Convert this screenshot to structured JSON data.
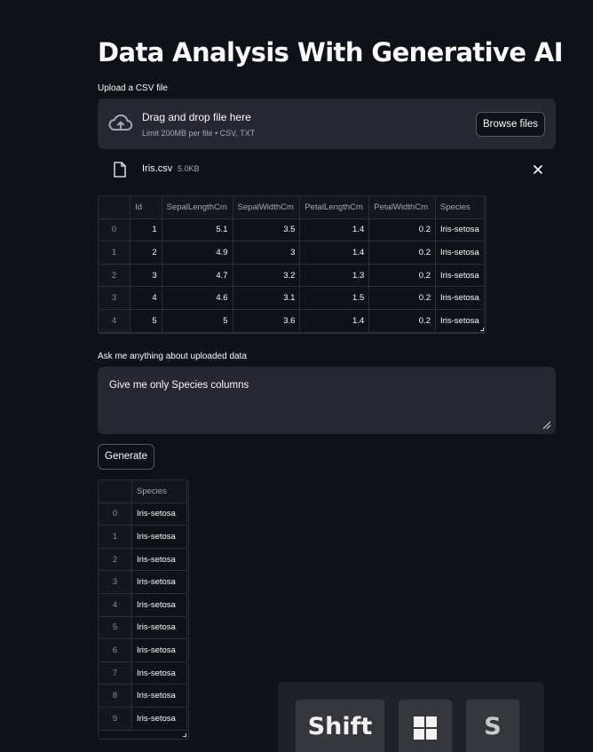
{
  "app": {
    "title": "Data Analysis With Generative AI"
  },
  "uploader": {
    "label": "Upload a CSV file",
    "drop_title": "Drag and drop file here",
    "limit_text": "Limit 200MB per file • CSV, TXT",
    "browse_label": "Browse files",
    "file": {
      "name": "Iris.csv",
      "size": "5.0KB"
    }
  },
  "preview_table": {
    "columns": [
      "",
      "Id",
      "SepalLengthCm",
      "SepalWidthCm",
      "PetalLengthCm",
      "PetalWidthCm",
      "Species"
    ],
    "rows": [
      [
        "0",
        "1",
        "5.1",
        "3.5",
        "1.4",
        "0.2",
        "Iris-setosa"
      ],
      [
        "1",
        "2",
        "4.9",
        "3",
        "1.4",
        "0.2",
        "Iris-setosa"
      ],
      [
        "2",
        "3",
        "4.7",
        "3.2",
        "1.3",
        "0.2",
        "Iris-setosa"
      ],
      [
        "3",
        "4",
        "4.6",
        "3.1",
        "1.5",
        "0.2",
        "Iris-setosa"
      ],
      [
        "4",
        "5",
        "5",
        "3.6",
        "1.4",
        "0.2",
        "Iris-setosa"
      ]
    ]
  },
  "question": {
    "label": "Ask me anything about uploaded data",
    "value": "Give me only Species columns"
  },
  "generate_label": "Generate",
  "result_table": {
    "columns": [
      "",
      "Species"
    ],
    "rows": [
      [
        "0",
        "Iris-setosa"
      ],
      [
        "1",
        "Iris-setosa"
      ],
      [
        "2",
        "Iris-setosa"
      ],
      [
        "3",
        "Iris-setosa"
      ],
      [
        "4",
        "Iris-setosa"
      ],
      [
        "5",
        "Iris-setosa"
      ],
      [
        "6",
        "Iris-setosa"
      ],
      [
        "7",
        "Iris-setosa"
      ],
      [
        "8",
        "Iris-setosa"
      ],
      [
        "9",
        "Iris-setosa"
      ]
    ]
  },
  "keyboard_overlay": {
    "shift_label": "Shift",
    "windows_key_icon": "windows-logo-icon",
    "s_label": "S"
  },
  "colors": {
    "background": "#0e1117",
    "panel": "#262730",
    "muted_text": "#a3a8b8"
  }
}
